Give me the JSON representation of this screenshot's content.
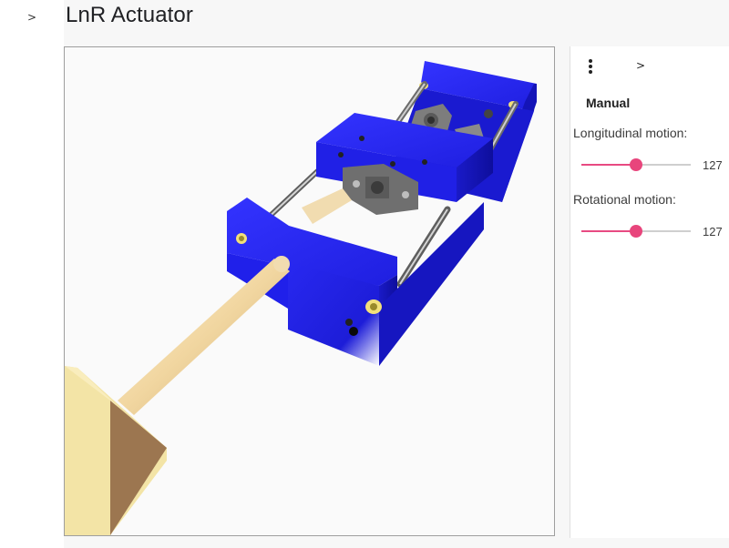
{
  "app": {
    "title": "LnR Actuator",
    "sidebar_toggle_glyph": ">"
  },
  "panel": {
    "menu_icon": "more-vert-icon",
    "expand_glyph": ">",
    "mode": "Manual",
    "controls": [
      {
        "label": "Longitudinal motion:",
        "value": "127",
        "min": 0,
        "max": 255,
        "fraction": 0.5
      },
      {
        "label": "Rotational motion:",
        "value": "127",
        "min": 0,
        "max": 255,
        "fraction": 0.5
      }
    ]
  },
  "colors": {
    "accent": "#e8457c",
    "model_body": "#1a1ad6",
    "rod": "#f5deb3",
    "block_light": "#f5e6a8",
    "block_dark": "#9c7a52",
    "viewer_bg": "#fafafa"
  }
}
